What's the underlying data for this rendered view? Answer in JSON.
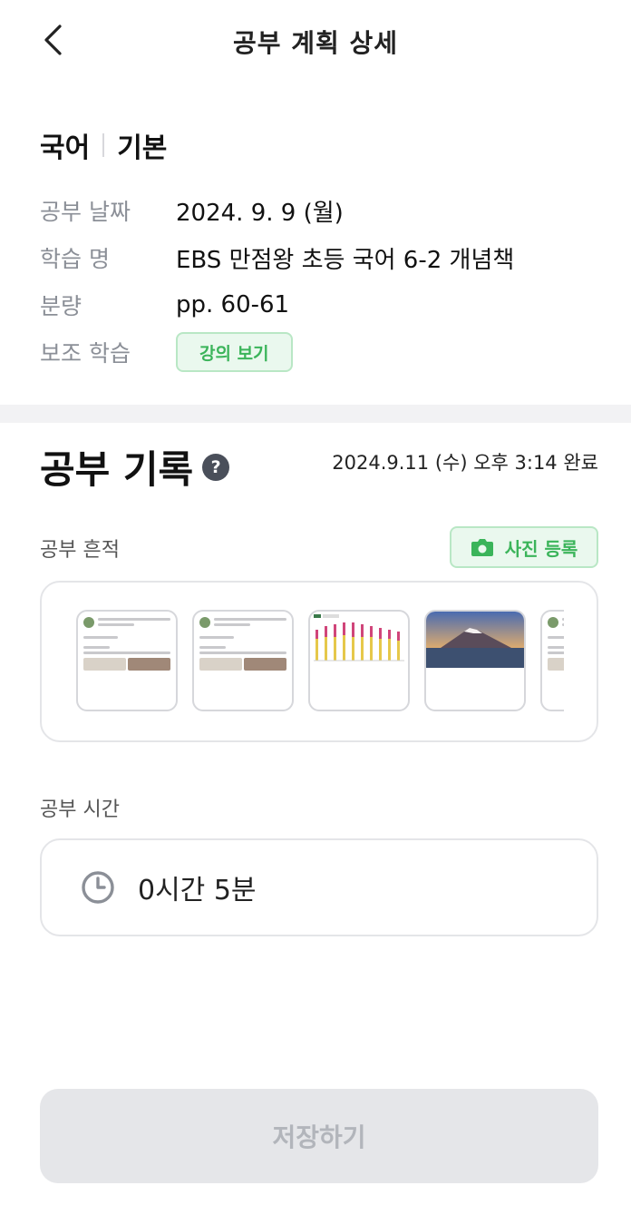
{
  "header": {
    "title": "공부 계획 상세"
  },
  "subject": {
    "name": "국어",
    "level": "기본"
  },
  "info": {
    "date_label": "공부 날짜",
    "date_value": "2024. 9. 9 (월)",
    "title_label": "학습 명",
    "title_value": "EBS 만점왕 초등 국어 6-2 개념책",
    "amount_label": "분량",
    "amount_value": "pp. 60-61",
    "support_label": "보조 학습",
    "support_button": "강의 보기"
  },
  "record": {
    "title": "공부 기록",
    "help_glyph": "?",
    "status": "2024.9.11 (수) 오후 3:14 완료"
  },
  "trace": {
    "label": "공부 흔적",
    "photo_button": "사진 등록",
    "thumbnails": [
      "post-screenshot",
      "post-screenshot",
      "bar-chart-screenshot",
      "mountain-photo",
      "post-screenshot"
    ]
  },
  "time": {
    "label": "공부 시간",
    "value": "0시간 5분"
  },
  "save": {
    "label": "저장하기"
  },
  "colors": {
    "accent_green": "#3bb45a",
    "chip_bg": "#eaf8ee",
    "disabled_bg": "#e5e6e9"
  }
}
